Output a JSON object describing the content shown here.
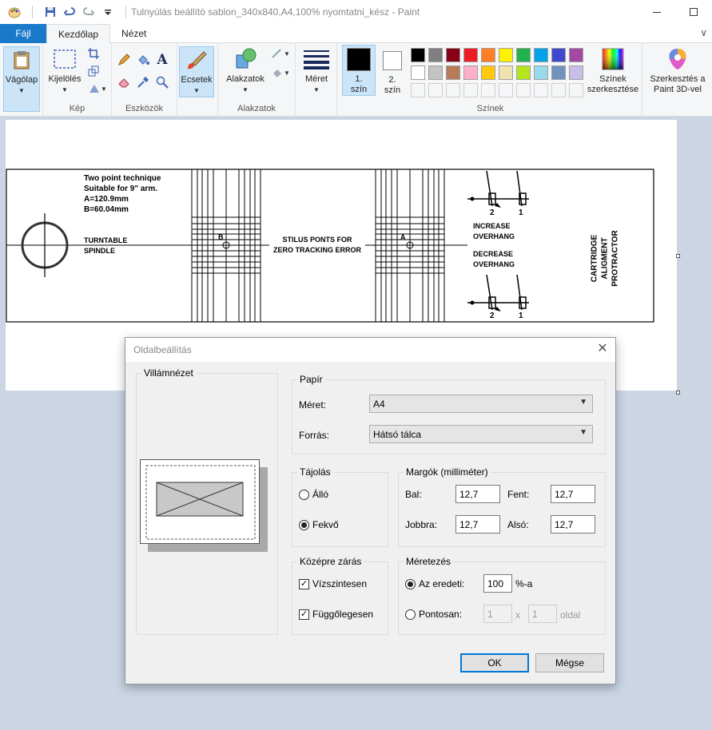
{
  "window": {
    "title": "Tulnyúlás beállító sablon_340x840,A4,100% nyomtatni_kész - Paint"
  },
  "tabs": [
    "Fájl",
    "Kezdőlap",
    "Nézet"
  ],
  "ribbon": {
    "vagolap": "Vágólap",
    "kijeloles": "Kijelölés",
    "kep_group": "Kép",
    "eszkozok_group": "Eszközök",
    "ecsetek": "Ecsetek",
    "alakzatok": "Alakzatok",
    "alakzatok_group": "Alakzatok",
    "meret": "Méret",
    "color1_line1": "1.",
    "color1_line2": "szín",
    "color2_line1": "2.",
    "color2_line2": "szín",
    "colors_edit_line1": "Színek",
    "colors_edit_line2": "szerkesztése",
    "colors_group": "Színek",
    "paint3d_line1": "Szerkesztés a",
    "paint3d_line2": "Paint 3D-vel",
    "palette_row1": [
      "#000000",
      "#7f7f7f",
      "#880015",
      "#ed1c24",
      "#ff7f27",
      "#fff200",
      "#22b14c",
      "#00a2e8",
      "#3f48cc",
      "#a349a4"
    ],
    "palette_row2": [
      "#ffffff",
      "#c3c3c3",
      "#b97a57",
      "#ffaec9",
      "#ffc90e",
      "#efe4b0",
      "#b5e61d",
      "#99d9ea",
      "#7092be",
      "#c8bfe7"
    ]
  },
  "canvas": {
    "text_technique": "Two point technique",
    "text_suitable": "Suitable for 9\" arm.",
    "text_a": "A=120.9mm",
    "text_b": "B=60.04mm",
    "text_turntable": "TURNTABLE",
    "text_spindle": "SPINDLE",
    "label_b": "B",
    "label_a": "A",
    "text_stilus1": "STILUS PONTS FOR",
    "text_stilus2": "ZERO TRACKING ERROR",
    "text_increase1": "INCREASE",
    "text_increase2": "OVERHANG",
    "text_decrease1": "DECREASE",
    "text_decrease2": "OVERHANG",
    "num_2": "2",
    "num_1": "1",
    "text_cartridge1": "CARTRIDGE",
    "text_cartridge2": "ALIGMENT",
    "text_cartridge3": "PROTRACTOR"
  },
  "dialog": {
    "title": "Oldalbeállítás",
    "preview_label": "Villámnézet",
    "paper_label": "Papír",
    "size_label": "Méret:",
    "size_value": "A4",
    "source_label": "Forrás:",
    "source_value": "Hátsó tálca",
    "orientation_label": "Tájolás",
    "portrait": "Álló",
    "landscape": "Fekvő",
    "margins_label": "Margók (milliméter)",
    "left_label": "Bal:",
    "left_value": "12,7",
    "top_label": "Fent:",
    "top_value": "12,7",
    "right_label": "Jobbra:",
    "right_value": "12,7",
    "bottom_label": "Alsó:",
    "bottom_value": "12,7",
    "center_label": "Középre zárás",
    "horizontally": "Vízszintesen",
    "vertically": "Függőlegesen",
    "scale_label": "Méretezés",
    "adjust_label": "Az eredeti:",
    "adjust_value": "100",
    "adjust_suffix": "%-a",
    "fit_label": "Pontosan:",
    "fit_w": "1",
    "fit_x": "x",
    "fit_h": "1",
    "fit_suffix": "oldal",
    "ok": "OK",
    "cancel": "Mégse"
  }
}
